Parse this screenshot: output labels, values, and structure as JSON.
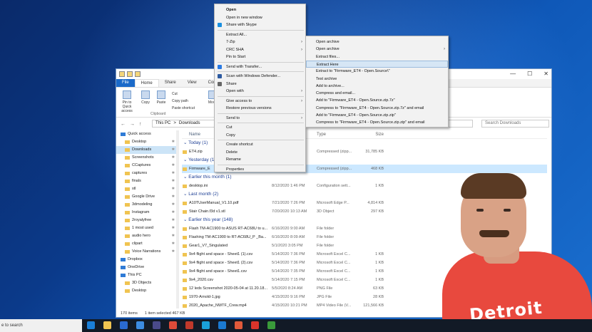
{
  "window": {
    "ribbon_tabs": [
      "File",
      "Home",
      "Share",
      "View",
      "Compress"
    ],
    "ribbon_buttons": [
      "Pin to Quick access",
      "Copy",
      "Paste",
      "Move"
    ],
    "ribbon_small": [
      "Cut",
      "Copy path",
      "Paste shortcut"
    ],
    "ribbon_group": "Clipboard",
    "address": [
      "This PC",
      ">",
      "Downloads"
    ],
    "search_placeholder": "Search Downloads",
    "controls": [
      "—",
      "☐",
      "✕"
    ]
  },
  "sidebar": {
    "items": [
      {
        "label": "Quick access",
        "root": true
      },
      {
        "label": "Desktop",
        "pin": true
      },
      {
        "label": "Downloads",
        "pin": true,
        "selected": true
      },
      {
        "label": "Screenshots",
        "pin": true
      },
      {
        "label": "CCaptures",
        "pin": true
      },
      {
        "label": "captures",
        "pin": true
      },
      {
        "label": "finals",
        "pin": true
      },
      {
        "label": "stl",
        "pin": true
      },
      {
        "label": "Google Drive",
        "pin": true
      },
      {
        "label": "3dmodeling",
        "pin": true
      },
      {
        "label": "Instagram",
        "pin": true
      },
      {
        "label": "2royalyfree",
        "pin": true
      },
      {
        "label": "1 most used",
        "pin": true
      },
      {
        "label": "audio hero",
        "pin": true
      },
      {
        "label": "clipart",
        "pin": true
      },
      {
        "label": "Voice Narrations",
        "pin": true
      },
      {
        "label": "Dropbox",
        "root": true
      },
      {
        "label": "OneDrive",
        "root": true
      },
      {
        "label": "This PC",
        "root": true
      },
      {
        "label": "3D Objects"
      },
      {
        "label": "Desktop"
      }
    ]
  },
  "columns": [
    "Name",
    "Type",
    "Size"
  ],
  "groups": [
    {
      "title": "Today (1)",
      "rows": [
        {
          "name": "ET4.zip",
          "date": "",
          "type": "Compressed (zipp...",
          "size": "31,785 KB"
        }
      ]
    },
    {
      "title": "Yesterday (1)",
      "rows": [
        {
          "name": "Firmware_E",
          "date": "",
          "type": "Compressed (zipp...",
          "size": "468 KB",
          "sel": true
        }
      ]
    },
    {
      "title": "Earlier this month (1)",
      "rows": [
        {
          "name": "desktop.ini",
          "date": "8/12/2020 1:46 PM",
          "type": "Configuration sett...",
          "size": "1 KB"
        }
      ]
    },
    {
      "title": "Last month (2)",
      "rows": [
        {
          "name": "A10TUserManual_V1.10.pdf",
          "date": "7/21/2020 7:26 PM",
          "type": "Microsoft Edge P...",
          "size": "4,814 KB"
        },
        {
          "name": "Stair Chain.f3d v1.stl",
          "date": "7/20/2020 10:13 AM",
          "type": "3D Object",
          "size": "297 KB"
        }
      ]
    },
    {
      "title": "Earlier this year (148)",
      "rows": [
        {
          "name": "Flash TM-AC1900 to ASUS RT-AC68U to u...",
          "date": "6/16/2020 9:00 AM",
          "type": "File folder",
          "size": ""
        },
        {
          "name": "Flashing TM-AC1900 to RT-AC68U_P _Ba...",
          "date": "6/16/2020 8:09 AM",
          "type": "File folder",
          "size": ""
        },
        {
          "name": "Gear1_V7_Singulated",
          "date": "5/1/2020 3:05 PM",
          "type": "File folder",
          "size": ""
        },
        {
          "name": "9x4 flight and space - Sheet1 (1).csv",
          "date": "5/14/2020 7:36 PM",
          "type": "Microsoft Excel C...",
          "size": "1 KB"
        },
        {
          "name": "9x4 flight and space - Sheet1 (2).csv",
          "date": "5/14/2020 7:36 PM",
          "type": "Microsoft Excel C...",
          "size": "1 KB"
        },
        {
          "name": "9x4 flight and space - Sheet1.csv",
          "date": "5/14/2020 7:35 PM",
          "type": "Microsoft Excel C...",
          "size": "1 KB"
        },
        {
          "name": "9x4_2020.csv",
          "date": "5/14/2020 7:15 PM",
          "type": "Microsoft Excel C...",
          "size": "1 KB"
        },
        {
          "name": "12 leds Screenshot 2020-05-04 at 11.20.18...",
          "date": "5/5/2020 8:24 AM",
          "type": "PNG File",
          "size": "63 KB"
        },
        {
          "name": "1970-Arnold-1.jpg",
          "date": "4/15/2020 9:16 PM",
          "type": "JPG File",
          "size": "28 KB"
        },
        {
          "name": "2020_Apache_NWTF_Crew.mp4",
          "date": "4/15/2020 10:21 PM",
          "type": "MP4 Video File (V...",
          "size": "121,566 KB"
        },
        {
          "name": "2020-04-15 (1).jpeg",
          "date": "4/15/2020 7:50 PM",
          "type": "JPEG File",
          "size": "39 KB"
        },
        {
          "name": "2020-04-15 (2).jpeg",
          "date": "4/15/2020 7:51 PM",
          "type": "JPG File",
          "size": "33 KB"
        }
      ]
    }
  ],
  "status": {
    "count": "170 items",
    "selected": "1 item selected  467 KB"
  },
  "context_menu": [
    {
      "label": "Open",
      "bold": true
    },
    {
      "label": "Open in new window"
    },
    {
      "label": "Share with Skype",
      "icon": "#1a8fe0"
    },
    {
      "sep": true
    },
    {
      "label": "Extract All..."
    },
    {
      "label": "7-Zip",
      "arrow": true
    },
    {
      "label": "CRC SHA",
      "arrow": true
    },
    {
      "label": "Pin to Start"
    },
    {
      "sep": true
    },
    {
      "label": "Send with Transfer...",
      "icon": "#2a7ae2"
    },
    {
      "sep": true
    },
    {
      "label": "Scan with Windows Defender...",
      "icon": "#2c5aa0"
    },
    {
      "label": "Share",
      "icon": "#666666"
    },
    {
      "label": "Open with",
      "arrow": true
    },
    {
      "sep": true
    },
    {
      "label": "Give access to",
      "arrow": true
    },
    {
      "label": "Restore previous versions"
    },
    {
      "sep": true
    },
    {
      "label": "Send to",
      "arrow": true
    },
    {
      "sep": true
    },
    {
      "label": "Cut"
    },
    {
      "label": "Copy"
    },
    {
      "sep": true
    },
    {
      "label": "Create shortcut"
    },
    {
      "label": "Delete"
    },
    {
      "label": "Rename"
    },
    {
      "sep": true
    },
    {
      "label": "Properties"
    }
  ],
  "submenu": [
    {
      "label": "Open archive"
    },
    {
      "label": "Open archive",
      "arrow": true
    },
    {
      "label": "Extract files..."
    },
    {
      "label": "Extract Here",
      "hl": true
    },
    {
      "label": "Extract to \"Firmware_ET4 - Open.Source\\\""
    },
    {
      "label": "Test archive"
    },
    {
      "label": "Add to archive..."
    },
    {
      "label": "Compress and email..."
    },
    {
      "label": "Add to \"Firmware_ET4 - Open.Source.zip.7z\""
    },
    {
      "label": "Compress to \"Firmware_ET4 - Open.Source.zip.7z\" and email"
    },
    {
      "label": "Add to \"Firmware_ET4 - Open.Source.zip.zip\""
    },
    {
      "label": "Compress to \"Firmware_ET4 - Open.Source.zip.zip\" and email"
    }
  ],
  "shirt_text": "Detroit",
  "taskbar": {
    "search_text": "e to search",
    "icons": [
      {
        "name": "edge-icon",
        "color": "#1a7fd8"
      },
      {
        "name": "file-explorer-icon",
        "color": "#f0c451"
      },
      {
        "name": "store-icon",
        "color": "#2a6ad0"
      },
      {
        "name": "mail-icon",
        "color": "#3c8be0"
      },
      {
        "name": "photos-icon",
        "color": "#4a4a8a"
      },
      {
        "name": "chrome-icon",
        "color": "#dd4b39"
      },
      {
        "name": "browser-icon",
        "color": "#c0392b"
      },
      {
        "name": "app-icon-c",
        "color": "#1aa0d8"
      },
      {
        "name": "edge-legacy-icon",
        "color": "#1b7ad0"
      },
      {
        "name": "chrome-alt-icon",
        "color": "#e05a3a"
      },
      {
        "name": "app-icon-red",
        "color": "#d9342b"
      },
      {
        "name": "camtasia-icon",
        "color": "#3a9a3a"
      }
    ]
  }
}
